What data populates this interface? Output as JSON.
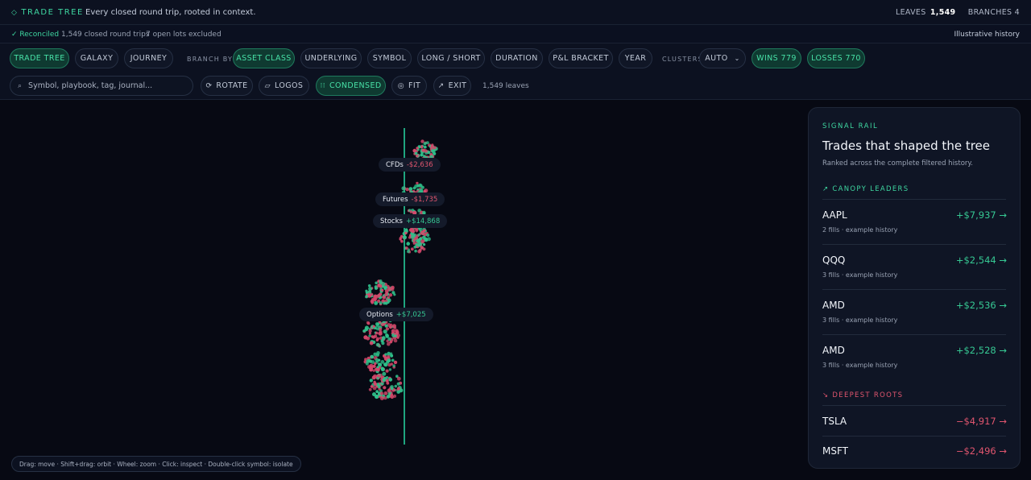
{
  "header": {
    "brand": "TRADE TREE",
    "tagline": "Every closed round trip, rooted in context.",
    "leaves_label": "LEAVES",
    "leaves_value": "1,549",
    "branches": "BRANCHES 4"
  },
  "status": {
    "reconciled": "✓ Reconciled",
    "closed": "1,549 closed round trips",
    "excluded": "7 open lots excluded",
    "illustrative": "Illustrative history"
  },
  "toolbar": {
    "views": [
      "TRADE TREE",
      "GALAXY",
      "JOURNEY"
    ],
    "branch_by_label": "BRANCH BY",
    "branch_options": [
      "ASSET CLASS",
      "UNDERLYING",
      "SYMBOL",
      "LONG / SHORT",
      "DURATION",
      "P&L BRACKET",
      "YEAR"
    ],
    "clusters_label": "CLUSTERS",
    "clusters_value": "AUTO",
    "wins": "WINS 779",
    "losses": "LOSSES 770",
    "search_placeholder": "Symbol, playbook, tag, journal...",
    "rotate": "ROTATE",
    "logos": "LOGOS",
    "condensed": "CONDENSED",
    "fit": "FIT",
    "exit": "EXIT",
    "leaf_count": "1,549 leaves"
  },
  "tree": {
    "branches": [
      {
        "name": "CFDs",
        "pnl": "-$2,636",
        "positive": false
      },
      {
        "name": "Futures",
        "pnl": "-$1,735",
        "positive": false
      },
      {
        "name": "Stocks",
        "pnl": "+$14,868",
        "positive": true
      },
      {
        "name": "Options",
        "pnl": "+$7,025",
        "positive": true
      }
    ],
    "colors": {
      "trunk": "#1fa57f",
      "win": "#2fbf8a",
      "loss": "#d4476a"
    },
    "hint": "Drag: move · Shift+drag: orbit · Wheel: zoom · Click: inspect · Double-click symbol: isolate"
  },
  "rail": {
    "eyebrow": "SIGNAL RAIL",
    "title": "Trades that shaped the tree",
    "subtitle": "Ranked across the complete filtered history.",
    "leaders_label": "↗ CANOPY LEADERS",
    "leaders": [
      {
        "symbol": "AAPL",
        "pnl": "+$7,937 →",
        "meta": "2 fills · example history"
      },
      {
        "symbol": "QQQ",
        "pnl": "+$2,544 →",
        "meta": "3 fills · example history"
      },
      {
        "symbol": "AMD",
        "pnl": "+$2,536 →",
        "meta": "3 fills · example history"
      },
      {
        "symbol": "AMD",
        "pnl": "+$2,528 →",
        "meta": "3 fills · example history"
      }
    ],
    "roots_label": "↘ DEEPEST ROOTS",
    "roots": [
      {
        "symbol": "TSLA",
        "pnl": "−$4,917 →"
      },
      {
        "symbol": "MSFT",
        "pnl": "−$2,496 →"
      }
    ]
  }
}
